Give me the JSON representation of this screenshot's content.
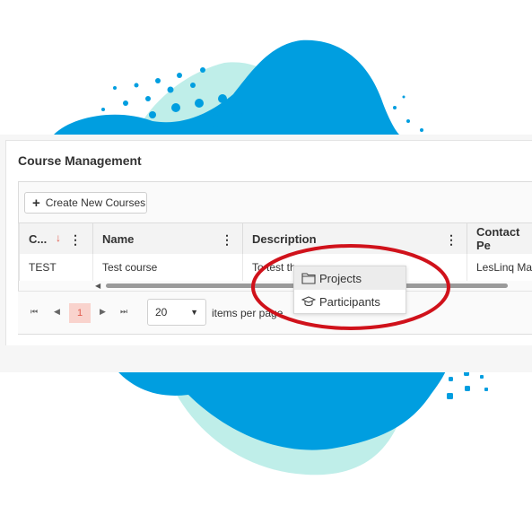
{
  "page": {
    "title": "Course Management"
  },
  "toolbar": {
    "create_label": "Create New Courses",
    "create_icon": "plus-icon"
  },
  "grid": {
    "columns": [
      {
        "label": "C...",
        "sorted": "descending"
      },
      {
        "label": "Name"
      },
      {
        "label": "Description"
      },
      {
        "label": "Contact Pe"
      }
    ],
    "rows": [
      {
        "code": "TEST",
        "name": "Test course",
        "description": "To test th",
        "contact": "LesLinq Ma"
      }
    ]
  },
  "pager": {
    "current_page": "1",
    "page_size": "20",
    "items_per_page_label": "items per page"
  },
  "context_menu": {
    "items": [
      {
        "label": "Projects",
        "icon": "folder-icon"
      },
      {
        "label": "Participants",
        "icon": "graduation-cap-icon"
      }
    ]
  },
  "colors": {
    "accent": "#e15b4c",
    "blob_blue": "#009ee0",
    "blob_mint": "#bfeee9",
    "annotation_red": "#d0121b"
  }
}
